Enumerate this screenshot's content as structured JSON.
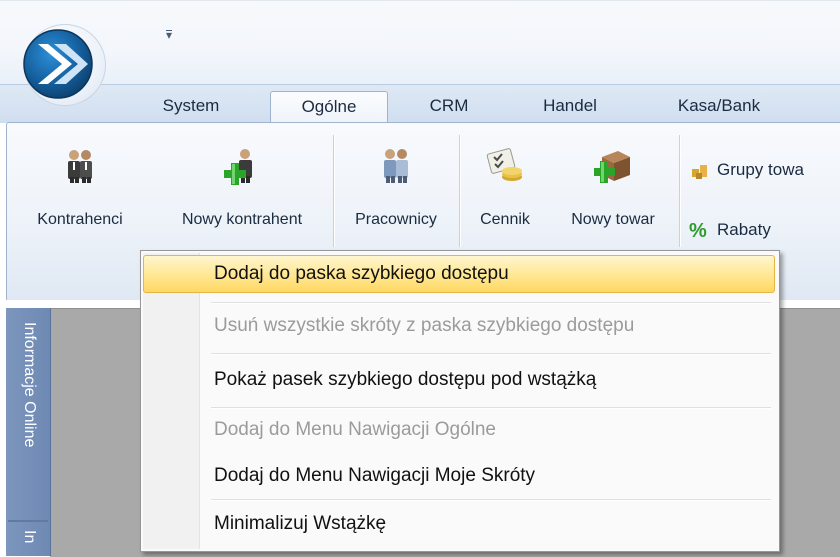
{
  "quick_access": {
    "dropdown_glyph": "▾"
  },
  "tabs": [
    {
      "label": "System",
      "active": false
    },
    {
      "label": "Ogólne",
      "active": true
    },
    {
      "label": "CRM",
      "active": false
    },
    {
      "label": "Handel",
      "active": false
    },
    {
      "label": "Kasa/Bank",
      "active": false
    }
  ],
  "ribbon": {
    "buttons": [
      {
        "label": "Kontrahenci",
        "icon": "people-icon"
      },
      {
        "label": "Nowy kontrahent",
        "icon": "add-person-icon"
      },
      {
        "label": "Pracownicy",
        "icon": "employees-icon"
      },
      {
        "label": "Cennik",
        "icon": "price-list-icon"
      },
      {
        "label": "Nowy towar",
        "icon": "add-box-icon"
      }
    ],
    "small_items": [
      {
        "label": "Grupy towa",
        "icon": "product-groups-icon"
      },
      {
        "label": "Rabaty",
        "icon": "percent-icon",
        "glyph": "%"
      }
    ]
  },
  "side_panel": {
    "tabs": [
      "Informacje Online",
      "In"
    ]
  },
  "context_menu": {
    "items": [
      {
        "label": "Dodaj do paska szybkiego dostępu",
        "state": "highlighted"
      },
      {
        "label": "Usuń wszystkie skróty z paska szybkiego dostępu",
        "state": "disabled"
      },
      {
        "label": "Pokaż pasek szybkiego dostępu pod wstążką",
        "state": "enabled"
      },
      {
        "label": "Dodaj do Menu Nawigacji Ogólne",
        "state": "disabled"
      },
      {
        "label": "Dodaj do Menu Nawigacji Moje Skróty",
        "state": "enabled"
      },
      {
        "label": "Minimalizuj Wstążkę",
        "state": "enabled"
      }
    ]
  },
  "colors": {
    "accent_blue": "#1d7fc9",
    "ribbon_border": "#9fb3cd",
    "menu_highlight": "#ffe896",
    "side_panel": "#7c96bd",
    "workarea": "#a9a9a9"
  }
}
